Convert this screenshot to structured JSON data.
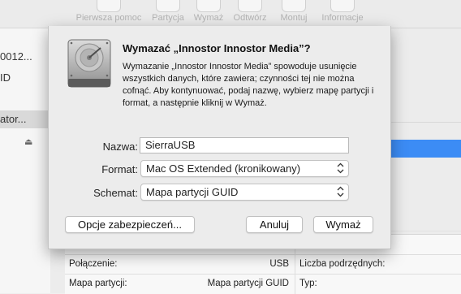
{
  "toolbar": {
    "items": [
      {
        "label": "Pierwsza pomoc"
      },
      {
        "label": "Partycja"
      },
      {
        "label": "Wymaż"
      },
      {
        "label": "Odtwórz"
      },
      {
        "label": "Montuj"
      },
      {
        "label": "Informacje"
      }
    ]
  },
  "sidebar": {
    "items": [
      {
        "label": "0012..."
      },
      {
        "label": "ID"
      },
      {
        "label": "ator..."
      }
    ]
  },
  "info_table": {
    "rows": [
      {
        "left_label": "Połączenie:",
        "left_value": "USB",
        "right_label": "Liczba podrzędnych:"
      },
      {
        "left_label": "Mapa partycji:",
        "left_value": "Mapa partycji GUID",
        "right_label": "Typ:"
      }
    ]
  },
  "dialog": {
    "title": "Wymazać „Innostor Innostor Media”?",
    "message": "Wymazanie „Innostor Innostor Media” spowoduje usunięcie wszystkich danych, które zawiera; czynności tej nie można cofnąć. Aby kontynuować, podaj nazwę, wybierz mapę partycji i format, a następnie kliknij w Wymaż.",
    "name_label": "Nazwa:",
    "name_value": "SierraUSB",
    "format_label": "Format:",
    "format_value": "Mac OS Extended (kronikowany)",
    "scheme_label": "Schemat:",
    "scheme_value": "Mapa partycji GUID",
    "security_button": "Opcje zabezpieczeń...",
    "cancel_button": "Anuluj",
    "erase_button": "Wymaż"
  },
  "colors": {
    "selection_blue": "#3c8cf5",
    "sheet_bg": "#ececec"
  }
}
